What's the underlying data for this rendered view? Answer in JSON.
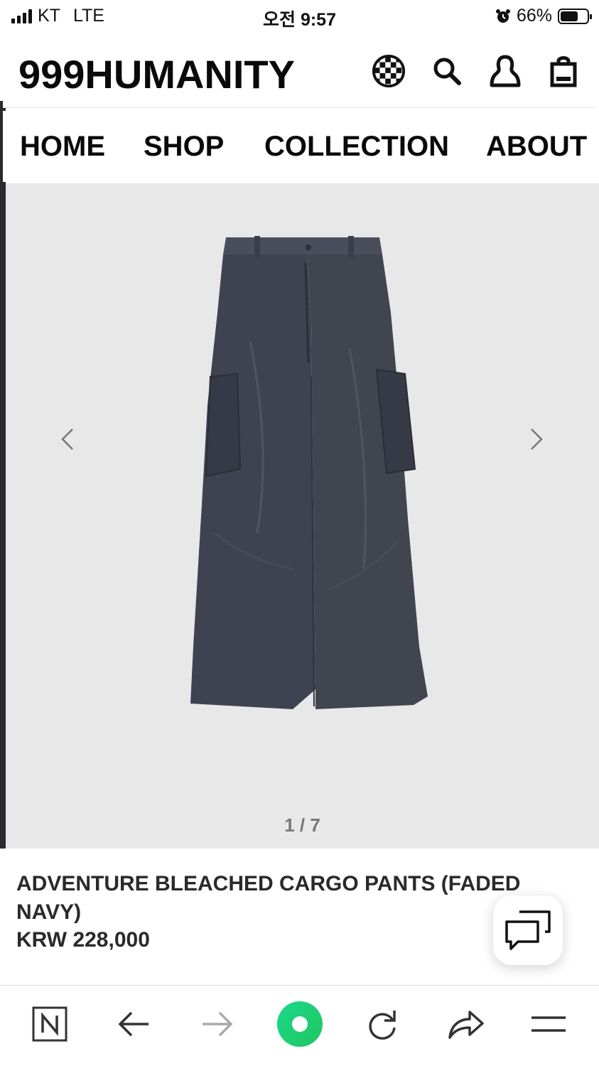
{
  "status_bar": {
    "carrier": "KT",
    "network": "LTE",
    "time": "오전 9:57",
    "battery": "66%",
    "battery_level": 0.66
  },
  "header": {
    "logo": "999HUMANITY",
    "icons": [
      "globe-icon",
      "search-icon",
      "account-icon",
      "cart-icon"
    ]
  },
  "nav": {
    "items": [
      {
        "label": "HOME"
      },
      {
        "label": "SHOP"
      },
      {
        "label": "COLLECTION"
      },
      {
        "label": "ABOUT"
      }
    ]
  },
  "gallery": {
    "counter": "1 / 7",
    "current": 1,
    "total": 7
  },
  "product": {
    "title": "ADVENTURE BLEACHED CARGO PANTS (FADED NAVY)",
    "price": "KRW 228,000"
  },
  "browser_bar": {
    "icons": [
      "naver-icon",
      "back-arrow-icon",
      "forward-arrow-icon",
      "home-circle-icon",
      "reload-icon",
      "share-icon",
      "menu-icon"
    ]
  },
  "colors": {
    "accent_green": "#1fd36b",
    "gallery_bg": "#e8e8e8",
    "pants": "#3e4250"
  }
}
